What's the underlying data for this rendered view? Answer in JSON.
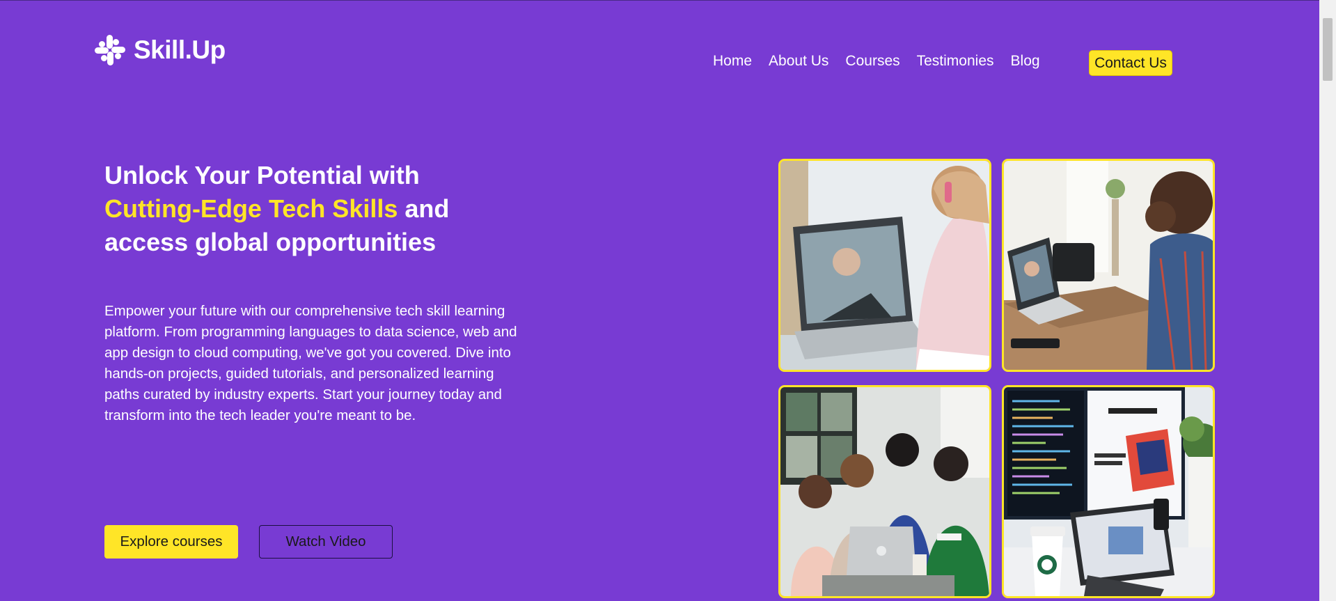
{
  "header": {
    "logo_text": "Skill.Up",
    "logo_icon": "slack-style-logo-icon",
    "nav": [
      {
        "label": "Home"
      },
      {
        "label": "About Us"
      },
      {
        "label": "Courses"
      },
      {
        "label": "Testimonies"
      },
      {
        "label": "Blog"
      }
    ],
    "contact_label": "Contact Us"
  },
  "hero": {
    "title_part1": "Unlock Your Potential with",
    "title_accent": "Cutting-Edge Tech Skills",
    "title_part2": " and access global opportunities",
    "description": "Empower your future with our comprehensive tech skill learning platform. From programming languages to data science, web and app design to cloud computing, we've got you covered. Dive into hands-on projects, guided tutorials, and personalized learning paths curated by industry experts. Start your journey today and transform into the tech leader you're meant to be.",
    "explore_label": "Explore courses",
    "watch_label": "Watch Video"
  },
  "gallery": [
    {
      "photo": "girl-video-call-laptop-photo"
    },
    {
      "photo": "man-video-call-laptop-photo"
    },
    {
      "photo": "group-around-laptop-photo"
    },
    {
      "photo": "desk-monitor-tablet-coffee-photo"
    }
  ],
  "colors": {
    "background": "#783bd3",
    "accent": "#ffe527",
    "text": "#ffffff"
  }
}
